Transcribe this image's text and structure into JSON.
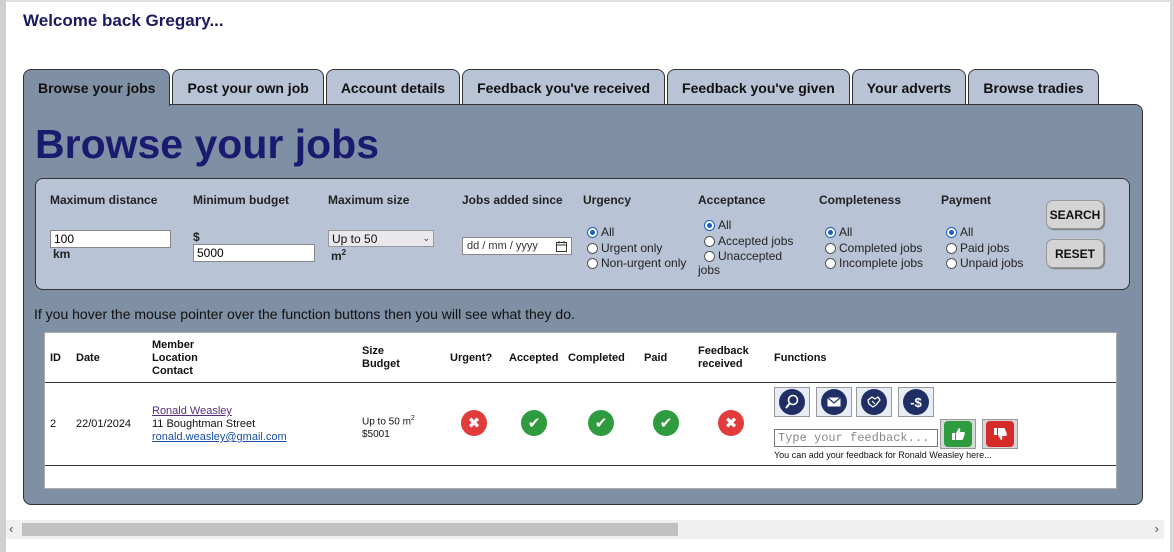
{
  "welcome": "Welcome back Gregary...",
  "tabs": [
    {
      "label": "Browse your jobs",
      "active": true
    },
    {
      "label": "Post your own job",
      "active": false
    },
    {
      "label": "Account details",
      "active": false
    },
    {
      "label": "Feedback you've received",
      "active": false
    },
    {
      "label": "Feedback you've given",
      "active": false
    },
    {
      "label": "Your adverts",
      "active": false
    },
    {
      "label": "Browse tradies",
      "active": false
    }
  ],
  "page_title": "Browse your jobs",
  "filters": {
    "max_distance": {
      "label": "Maximum distance",
      "value": "100",
      "unit": "km"
    },
    "min_budget": {
      "label": "Minimum budget",
      "currency": "$",
      "value": "5000"
    },
    "max_size": {
      "label": "Maximum size",
      "selected": "Up to 50",
      "unit": "m",
      "unit_sup": "2"
    },
    "jobs_added_since": {
      "label": "Jobs added since",
      "placeholder": "dd / mm / yyyy"
    },
    "urgency": {
      "label": "Urgency",
      "options": [
        "All",
        "Urgent only",
        "Non-urgent only"
      ],
      "selected": "All"
    },
    "acceptance": {
      "label": "Acceptance",
      "options": [
        "All",
        "Accepted jobs",
        "Unaccepted",
        "jobs"
      ],
      "selected": "All"
    },
    "completeness": {
      "label": "Completeness",
      "options": [
        "All",
        "Completed jobs",
        "Incomplete jobs"
      ],
      "selected": "All"
    },
    "payment": {
      "label": "Payment",
      "options": [
        "All",
        "Paid jobs",
        "Unpaid jobs"
      ],
      "selected": "All"
    },
    "search_label": "SEARCH",
    "reset_label": "RESET"
  },
  "hint": "If you hover the mouse pointer over the function buttons then you will see what they do.",
  "table": {
    "headers": {
      "id": "ID",
      "date": "Date",
      "member": [
        "Member",
        "Location",
        "Contact"
      ],
      "size": [
        "Size",
        "Budget"
      ],
      "urgent": "Urgent?",
      "accepted": "Accepted",
      "completed": "Completed",
      "paid": "Paid",
      "feedback": [
        "Feedback",
        "received"
      ],
      "functions": "Functions"
    },
    "rows": [
      {
        "id": "2",
        "date": "22/01/2024",
        "member": "Ronald Weasley",
        "location": "11 Boughtman Street",
        "contact": "ronald.weasley@gmail.com",
        "size": "Up to 50 m",
        "size_sup": "2",
        "budget": "$5001",
        "urgent": false,
        "accepted": true,
        "completed": true,
        "paid": true,
        "feedback_received": false,
        "feedback_placeholder": "Type your feedback...",
        "feedback_note": "You can add your feedback for Ronald Weasley here..."
      }
    ]
  },
  "icons": {
    "yes": "✔",
    "no": "✖",
    "view": "search-icon",
    "email": "mail-icon",
    "accept": "handshake-icon",
    "pay": "-$"
  },
  "colors": {
    "panel": "#7f8fa4",
    "filter_box": "#b8c4d6",
    "title": "#1a1a6e",
    "yes": "#2e9b3e",
    "no": "#e23b3b"
  }
}
